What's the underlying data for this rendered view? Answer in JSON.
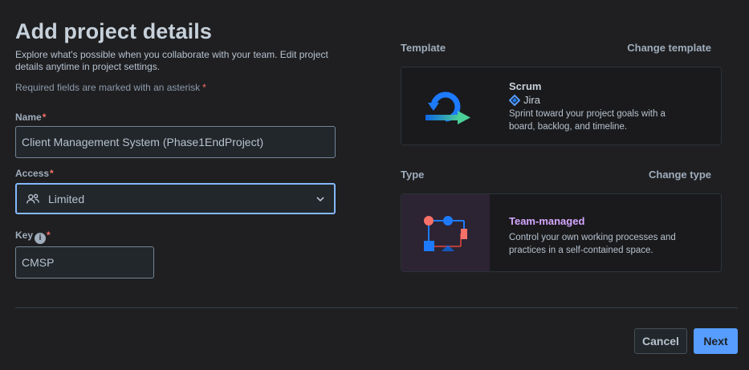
{
  "page": {
    "title": "Add project details",
    "intro": "Explore what's possible when you collaborate with your team. Edit project details anytime in project settings.",
    "required_note": "Required fields are marked with an asterisk",
    "required_marker": "*"
  },
  "fields": {
    "name": {
      "label": "Name",
      "value": "Client Management System (Phase1EndProject)"
    },
    "access": {
      "label": "Access",
      "value": "Limited"
    },
    "key": {
      "label": "Key",
      "value": "CMSP"
    }
  },
  "template": {
    "section_label": "Template",
    "change_link": "Change template",
    "name": "Scrum",
    "product": "Jira",
    "description": "Sprint toward your project goals with a board, backlog, and timeline."
  },
  "type": {
    "section_label": "Type",
    "change_link": "Change type",
    "name": "Team-managed",
    "description": "Control your own working processes and practices in a self-contained space."
  },
  "footer": {
    "cancel_label": "Cancel",
    "next_label": "Next"
  },
  "colors": {
    "background": "#1f1f21",
    "accent": "#579dff",
    "required": "#f87168",
    "team_managed": "#d6a6ff"
  }
}
